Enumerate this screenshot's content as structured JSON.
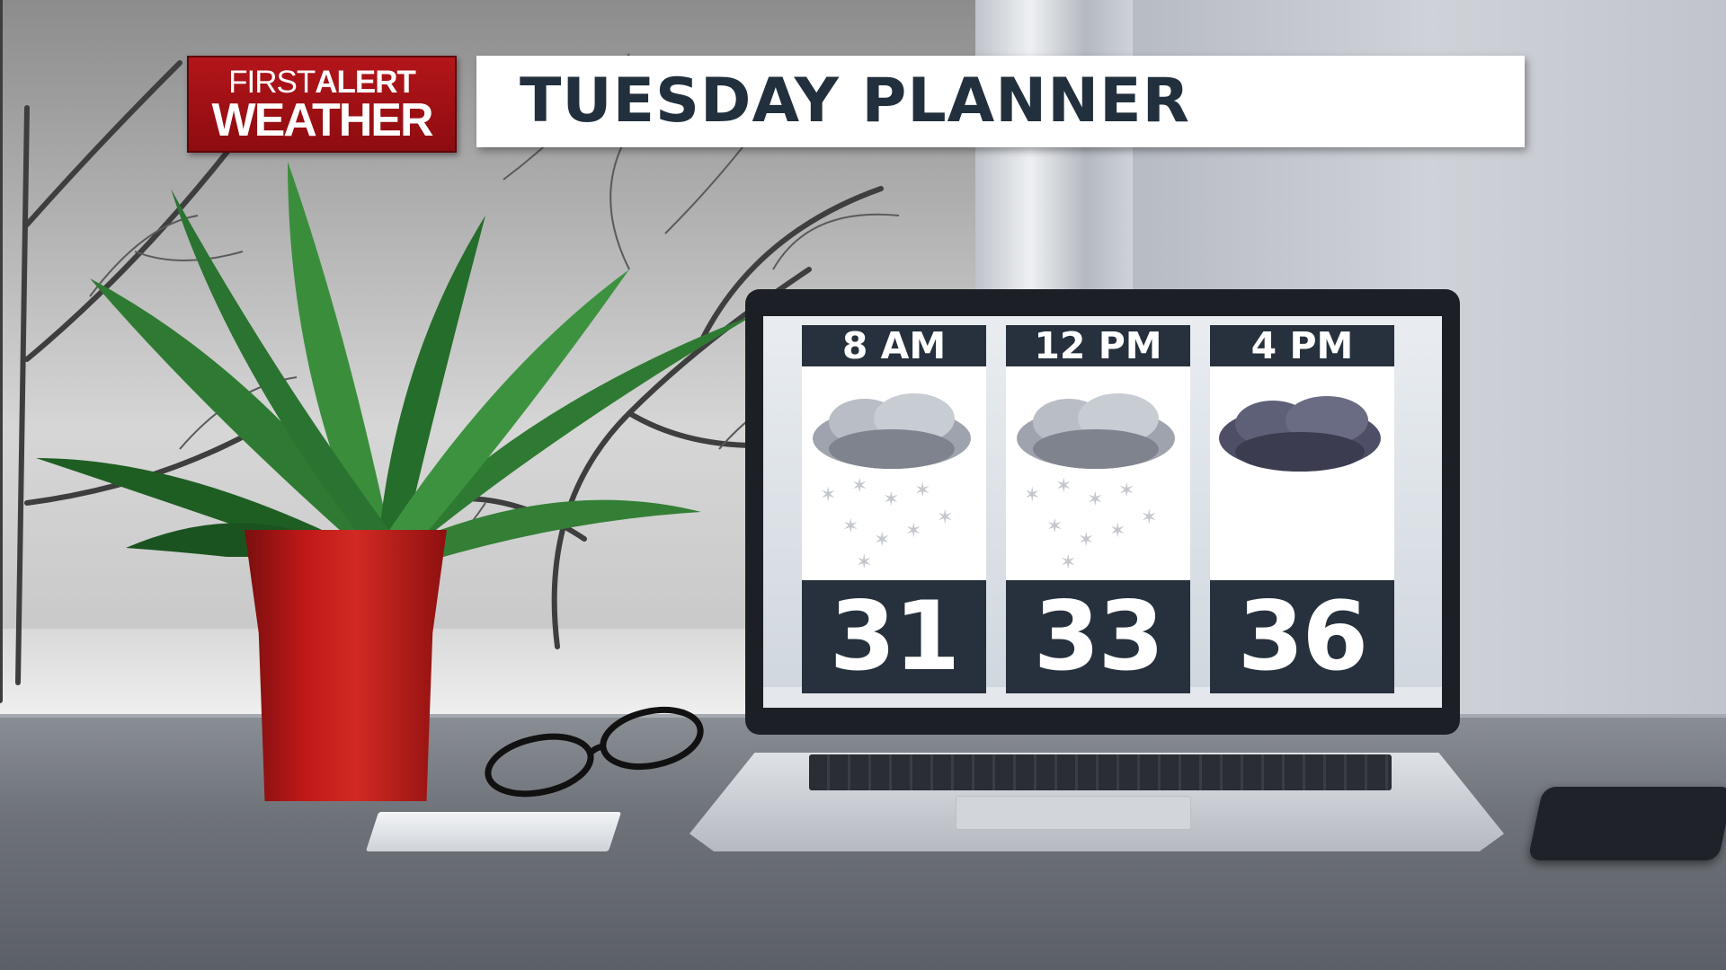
{
  "brand": {
    "line1_a": "FIRST",
    "line1_b": "ALERT",
    "line2": "WEATHER",
    "color": "#a81317"
  },
  "title": "TUESDAY PLANNER",
  "forecast": [
    {
      "time": "8 AM",
      "temp": "31",
      "icon": "cloud-snow-icon"
    },
    {
      "time": "12 PM",
      "temp": "33",
      "icon": "cloud-snow-icon"
    },
    {
      "time": "4 PM",
      "temp": "36",
      "icon": "dark-cloud-icon"
    }
  ],
  "colors": {
    "card_header": "#26313d",
    "title_text": "#22303d"
  }
}
